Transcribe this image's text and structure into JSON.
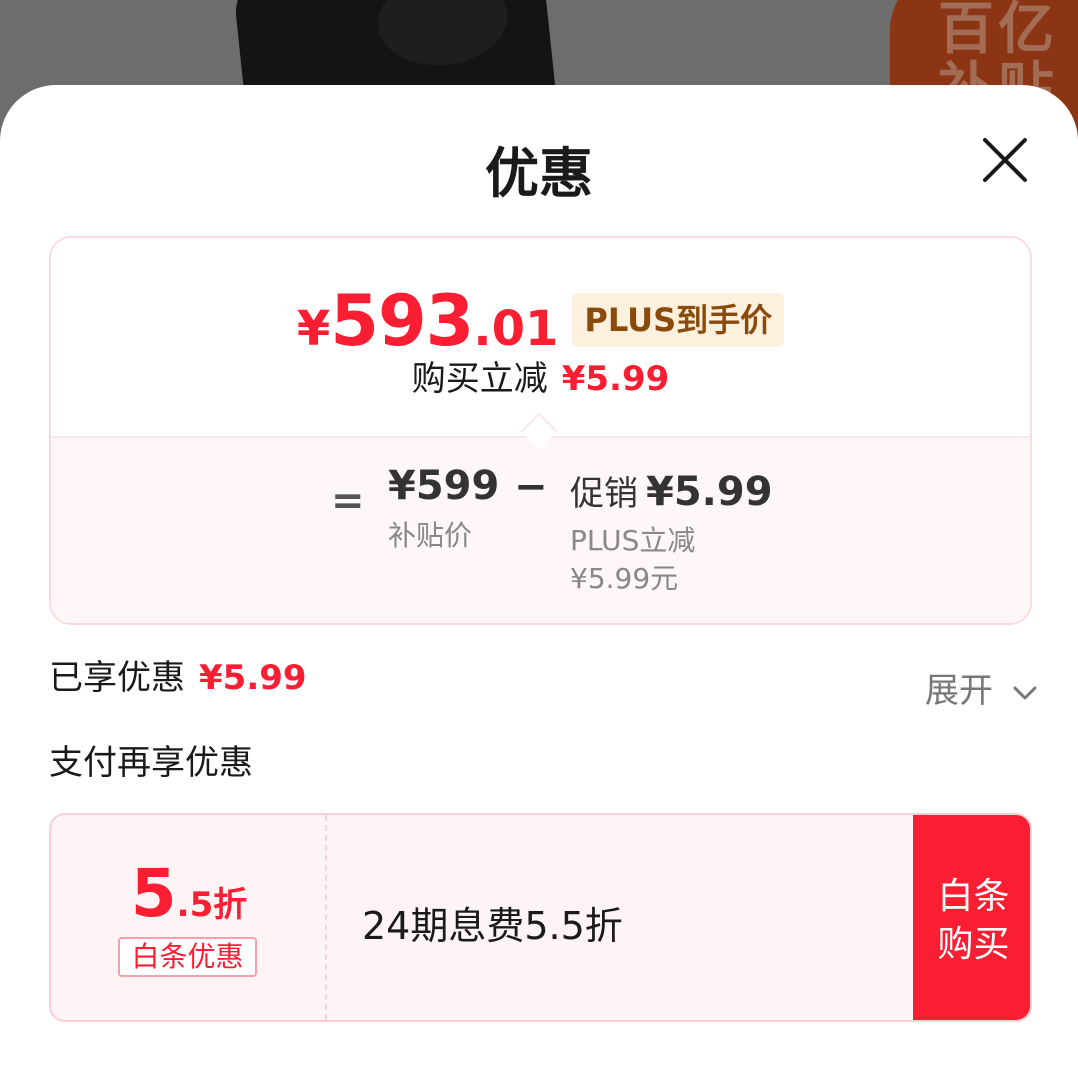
{
  "background": {
    "badge_text": "百亿补贴"
  },
  "sheet": {
    "title": "优惠"
  },
  "price_card": {
    "currency": "¥",
    "price_integer": "593",
    "price_decimal": ".01",
    "price_tag": "PLUS到手价",
    "reduce_label": "购买立减",
    "reduce_amount": "¥5.99",
    "equals": "=",
    "original_value": "¥599",
    "original_label": "补贴价",
    "minus": "−",
    "promo_label": "促销",
    "promo_value": "¥5.99",
    "promo_sub_1": "PLUS立减",
    "promo_sub_2": "¥5.99元"
  },
  "enjoyed": {
    "label": "已享优惠",
    "amount": "¥5.99",
    "expand_label": "展开"
  },
  "pay": {
    "title": "支付再享优惠",
    "card": {
      "rate_big": "5",
      "rate_small": ".5折",
      "tag": "白条优惠",
      "description": "24期息费5.5折",
      "button_label": "白条购买"
    }
  },
  "colors": {
    "accent_red": "#fa1e32",
    "plus_gold_bg": "#fdf0dd",
    "plus_gold_text": "#8a4a0c"
  }
}
